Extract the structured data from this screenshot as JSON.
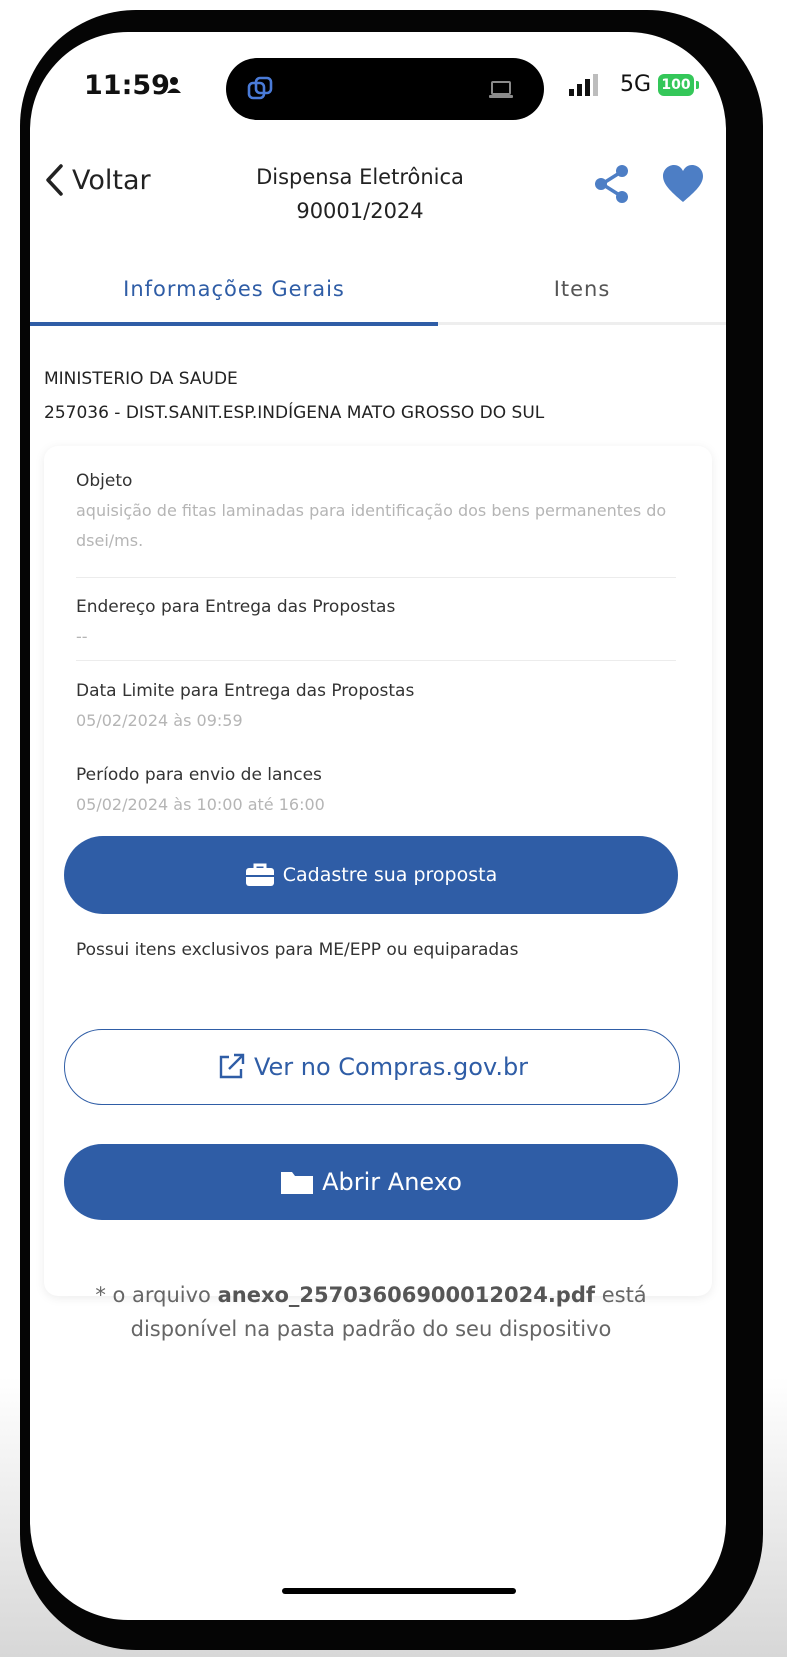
{
  "status_bar": {
    "time": "11:59",
    "network": "5G",
    "battery": "100"
  },
  "header": {
    "back_label": "Voltar",
    "title_line1": "Dispensa Eletrônica",
    "title_line2": "90001/2024"
  },
  "tabs": [
    {
      "label": "Informações Gerais"
    },
    {
      "label": "Itens"
    }
  ],
  "org": {
    "name": "MINISTERIO DA SAUDE",
    "unit": "257036 - DIST.SANIT.ESP.INDÍGENA MATO GROSSO DO SUL"
  },
  "fields": [
    {
      "label": "Objeto",
      "value": "aquisição de fitas laminadas para identificação dos bens permanentes do dsei/ms."
    },
    {
      "label": "Endereço para Entrega das Propostas",
      "value": "--"
    },
    {
      "label": "Data Limite para Entrega das Propostas",
      "value": "05/02/2024 às 09:59"
    },
    {
      "label": "Período para envio de lances",
      "value": "05/02/2024 às 10:00 até 16:00"
    }
  ],
  "buttons": {
    "submit_proposal": "Cadastre sua proposta",
    "view_compras": "Ver no Compras.gov.br",
    "open_attachment": "Abrir Anexo"
  },
  "exclusive_note": "Possui itens exclusivos para ME/EPP ou equiparadas",
  "footnote": {
    "prefix": "* o arquivo",
    "filename": "anexo_25703606900012024.pdf",
    "suffix": "está disponível na pasta padrão do seu dispositivo"
  },
  "colors": {
    "accent": "#2f5da6",
    "battery": "#34c759"
  }
}
